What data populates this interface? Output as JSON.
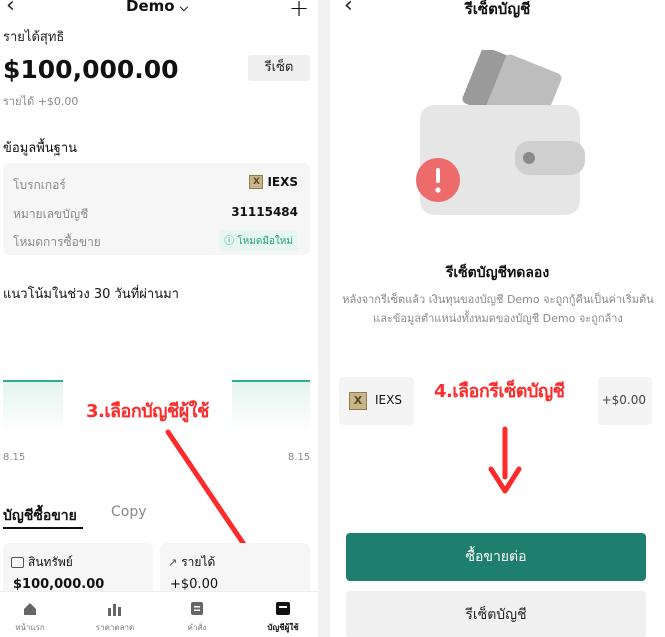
{
  "left": {
    "header": {
      "account_name": "Demo",
      "back_icon": "back-chevron-icon",
      "add_icon": "plus-icon"
    },
    "net_income_label": "รายได้สุทธิ",
    "balance": "$100,000.00",
    "reset_button": "รีเซ็ต",
    "income_change": "รายได้ +$0.00",
    "basic_info_title": "ข้อมูลพื้นฐาน",
    "info_rows": [
      {
        "label": "โบรกเกอร์",
        "value": "IEXS"
      },
      {
        "label": "หมายเลขบัญชี",
        "value": "31115484"
      },
      {
        "label": "โหมดการซื้อขาย",
        "value": "โหมดมือใหม่"
      }
    ],
    "trend_title": "แนวโน้มในช่วง 30 วันที่ผ่านมา",
    "chart_left_label": "8.15",
    "chart_right_label": "8.15",
    "annotation": "3.เลือกบัญชีผู้ใช้",
    "tabs": [
      {
        "label": "บัญชีซื้อขาย"
      },
      {
        "label": "Copy"
      }
    ],
    "cards": [
      {
        "label": "สินทรัพย์",
        "value": "$100,000.00"
      },
      {
        "label": "รายได้",
        "value": "+$0.00"
      }
    ],
    "nav": [
      {
        "label": "หน้าแรก",
        "icon": "home-icon"
      },
      {
        "label": "ราคาตลาด",
        "icon": "bar-chart-icon"
      },
      {
        "label": "คำสั่ง",
        "icon": "orders-icon"
      },
      {
        "label": "บัญชีผู้ใช้",
        "icon": "account-icon"
      }
    ],
    "accent_color": "#1f7f6e",
    "annotation_color": "#ff2a2a"
  },
  "right": {
    "header": {
      "title": "รีเซ็ตบัญชี"
    },
    "illustration_icon": "wallet-warning-icon",
    "heading": "รีเซ็ตบัญชีทดลอง",
    "description": "หลังจากรีเซ็ตแล้ว เงินทุนของบัญชี Demo จะถูกกู้คืนเป็นค่าเริ่มต้น และข้อมูลตำแหน่งทั้งหมดของบัญชี Demo จะถูกล้าง",
    "broker": "IEXS",
    "amount": "+$0.00",
    "annotation": "4.เลือกรีเซ็ตบัญชี",
    "continue_button": "ซื้อขายต่อ",
    "reset_button": "รีเซ็ตบัญชี"
  }
}
